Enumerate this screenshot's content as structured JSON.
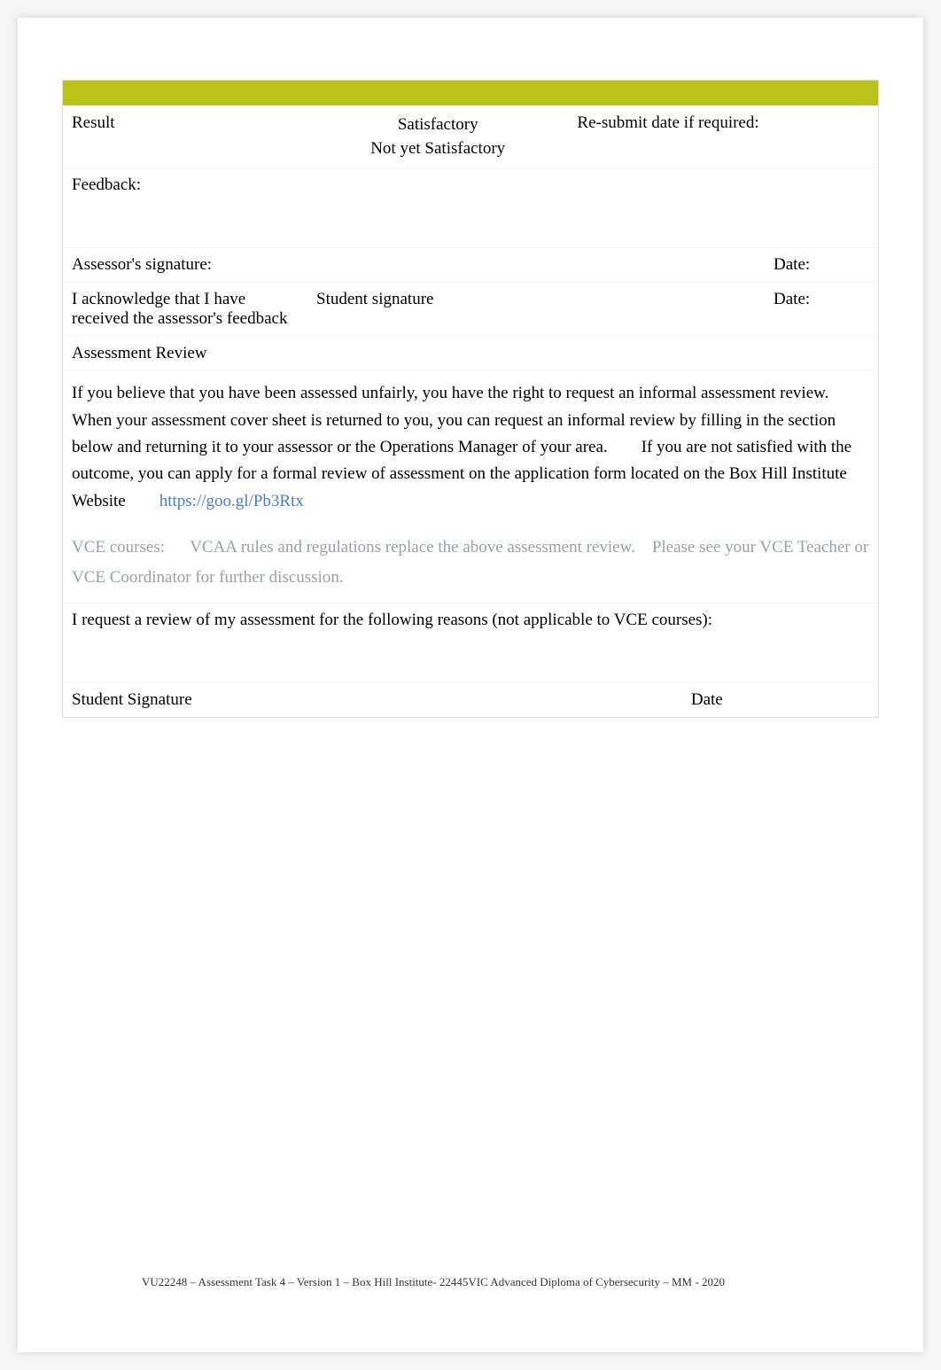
{
  "result": {
    "label": "Result",
    "option_satisfactory": "Satisfactory",
    "option_not_yet": "Not yet Satisfactory",
    "resubmit_label": "Re-submit date if required:",
    "resubmit_value": ""
  },
  "feedback": {
    "label": "Feedback:",
    "value": ""
  },
  "assessor": {
    "sig_label": "Assessor's signature:",
    "sig_value": "",
    "date_label": "Date:",
    "date_value": ""
  },
  "ack": {
    "text": "I acknowledge that I have received the assessor's feedback",
    "student_sig_label": "Student signature",
    "student_sig_value": "",
    "date_label": "Date:",
    "date_value": ""
  },
  "review": {
    "heading": "Assessment Review",
    "p1a": "If you believe that you have been assessed unfairly, you have the right to request an informal assessment review.",
    "p1b": "When your assessment cover sheet is returned to you, you can request an informal review by filling in the section below and returning it to your assessor or the Operations Manager of your area.",
    "p1c": "If you are not satisfied with the outcome, you can apply for a formal review of assessment on the application form located on the Box Hill Institute Website",
    "link": "https://goo.gl/Pb3Rtx",
    "vce_label": "VCE courses:",
    "vce_text": "VCAA rules and regulations replace the above assessment review.    Please see your VCE Teacher or VCE Coordinator for further discussion.",
    "reasons_label": "I request a review of my assessment for the following reasons (not applicable to VCE courses):",
    "reasons_value": "",
    "student_sig_label": "Student Signature",
    "student_sig_value": "",
    "date_label": "Date",
    "date_value": ""
  },
  "footer": {
    "text": "VU22248 – Assessment Task 4 – Version 1 – Box Hill Institute- 22445VIC Advanced Diploma of Cybersecurity – MM - 2020"
  }
}
